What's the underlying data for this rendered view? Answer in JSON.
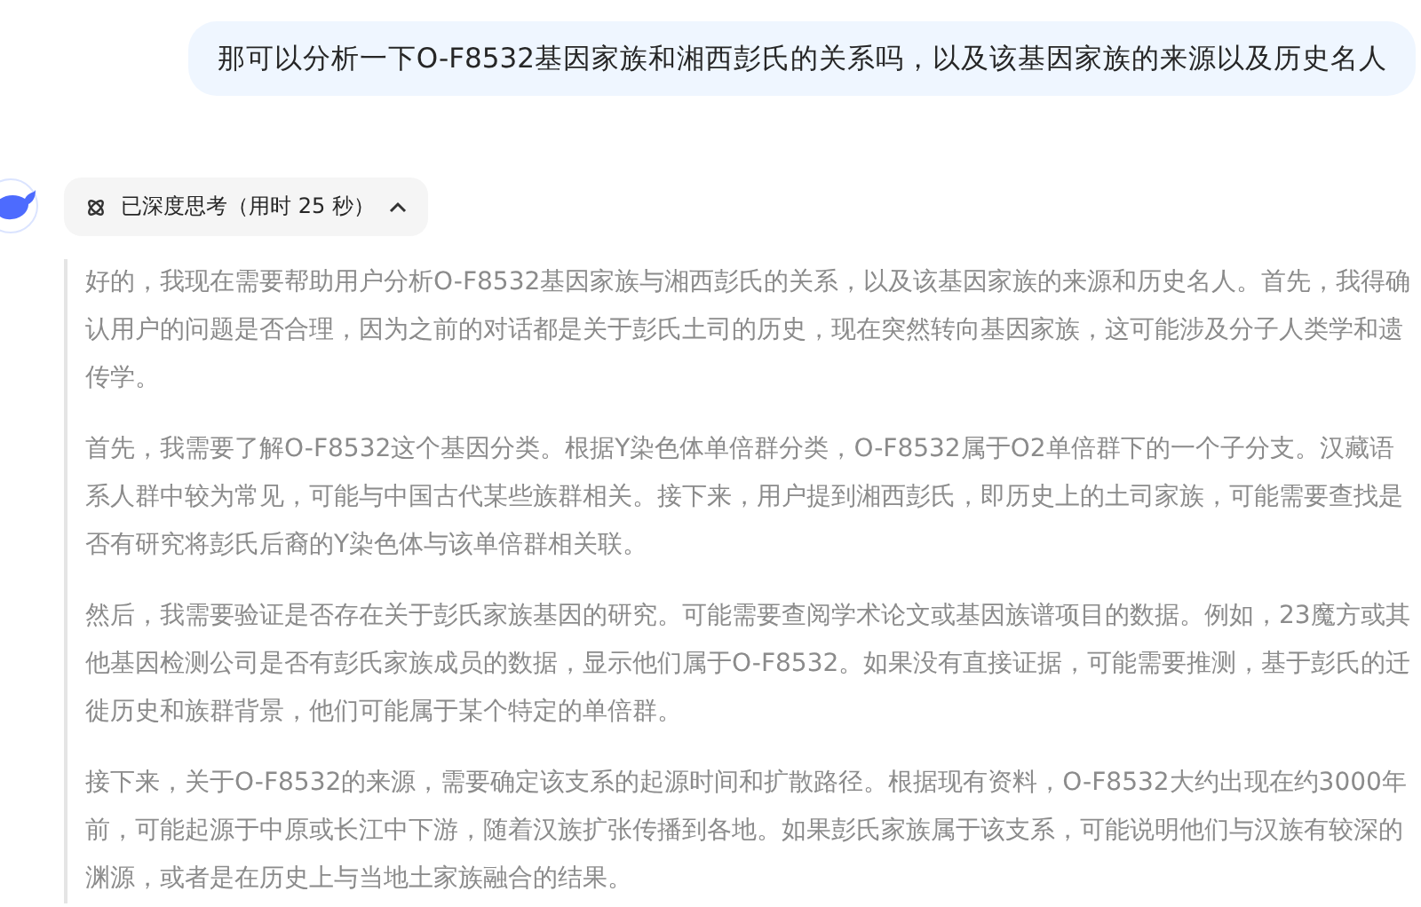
{
  "user_message": {
    "text": "那可以分析一下O-F8532基因家族和湘西彭氏的关系吗，以及该基因家族的来源以及历史名人"
  },
  "thinking_toggle": {
    "label": "已深度思考（用时 25 秒）",
    "expanded": true
  },
  "thinking_paragraphs": [
    "好的，我现在需要帮助用户分析O-F8532基因家族与湘西彭氏的关系，以及该基因家族的来源和历史名人。首先，我得确认用户的问题是否合理，因为之前的对话都是关于彭氏土司的历史，现在突然转向基因家族，这可能涉及分子人类学和遗传学。",
    "首先，我需要了解O-F8532这个基因分类。根据Y染色体单倍群分类，O-F8532属于O2单倍群下的一个子分支。汉藏语系人群中较为常见，可能与中国古代某些族群相关。接下来，用户提到湘西彭氏，即历史上的土司家族，可能需要查找是否有研究将彭氏后裔的Y染色体与该单倍群相关联。",
    "然后，我需要验证是否存在关于彭氏家族基因的研究。可能需要查阅学术论文或基因族谱项目的数据。例如，23魔方或其他基因检测公司是否有彭氏家族成员的数据，显示他们属于O-F8532。如果没有直接证据，可能需要推测，基于彭氏的迁徙历史和族群背景，他们可能属于某个特定的单倍群。",
    "接下来，关于O-F8532的来源，需要确定该支系的起源时间和扩散路径。根据现有资料，O-F8532大约出现在约3000年前，可能起源于中原或长江中下游，随着汉族扩张传播到各地。如果彭氏家族属于该支系，可能说明他们与汉族有较深的渊源，或者是在历史上与当地土家族融合的结果。"
  ]
}
